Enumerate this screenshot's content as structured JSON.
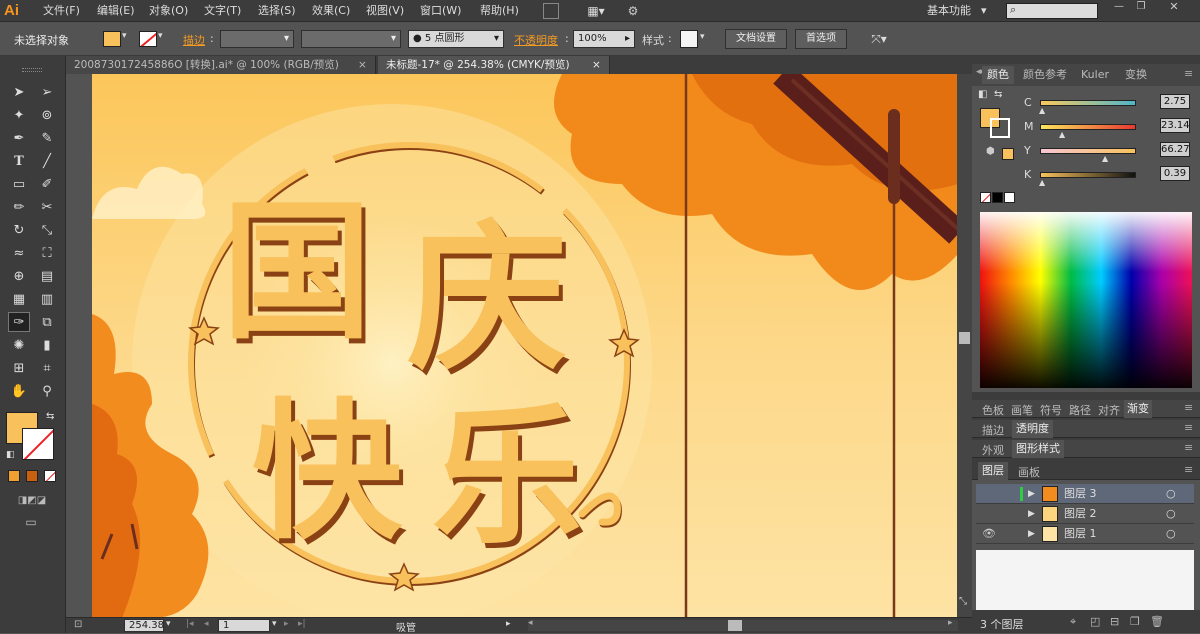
{
  "app": {
    "logo": "Ai",
    "workspace": "基本功能",
    "workspace_arrow": "▾"
  },
  "menu": [
    "文件(F)",
    "编辑(E)",
    "对象(O)",
    "文字(T)",
    "选择(S)",
    "效果(C)",
    "视图(V)",
    "窗口(W)",
    "帮助(H)"
  ],
  "control": {
    "selection": "未选择对象",
    "stroke_label": "描边",
    "brush": "● 5 点圆形",
    "opacity_label": "不透明度",
    "opacity": "100%",
    "style_label": "样式",
    "doc_setup": "文档设置",
    "prefs": "首选项"
  },
  "tabs": [
    "200873017245886O [转换].ai* @ 100% (RGB/预览)",
    "未标题-17* @ 254.38% (CMYK/预览)"
  ],
  "tab_close": "×",
  "canvas": {
    "line1_a": "国",
    "line1_b": "庆",
    "line2_a": "快",
    "line2_b": "乐"
  },
  "status": {
    "zoom": "254.38",
    "artboard": "1",
    "tool": "吸管"
  },
  "color_panel": {
    "tabs": [
      "颜色",
      "颜色参考",
      "Kuler",
      "变换"
    ],
    "channels": [
      {
        "label": "C",
        "value": "2.75"
      },
      {
        "label": "M",
        "value": "23.14"
      },
      {
        "label": "Y",
        "value": "66.27"
      },
      {
        "label": "K",
        "value": "0.39"
      }
    ]
  },
  "swatch_tabs": [
    "色板",
    "画笔",
    "符号",
    "路径",
    "对齐",
    "渐变"
  ],
  "stroke_tabs": [
    "描边",
    "透明度"
  ],
  "appearance_tabs": [
    "外观",
    "图形样式"
  ],
  "layers_panel": {
    "tabs": [
      "图层",
      "画板"
    ],
    "layers": [
      "图层 3",
      "图层 2",
      "图层 1"
    ],
    "count": "3 个图层"
  },
  "colors": {
    "fill": "#f8c15b",
    "accent": "#f59a23",
    "bg_warm": "#fcd57e"
  }
}
